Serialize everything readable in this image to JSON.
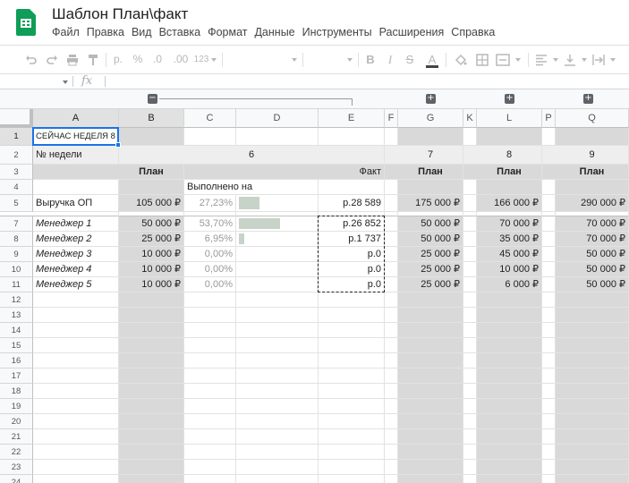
{
  "app": {
    "title": "Шаблон План\\факт",
    "menu": [
      "Файл",
      "Правка",
      "Вид",
      "Вставка",
      "Формат",
      "Данные",
      "Инструменты",
      "Расширения",
      "Справка"
    ]
  },
  "toolbar": {
    "currency": "р.",
    "percent": "%",
    "dec_decrease": ".0",
    "dec_increase": ".00",
    "more_formats": "123",
    "bold": "B",
    "italic": "I",
    "strike": "S",
    "text_color": "A"
  },
  "formula_bar": {
    "fx": "fx",
    "value": ""
  },
  "columns": [
    "A",
    "B",
    "C",
    "D",
    "E",
    "F",
    "G",
    "K",
    "L",
    "P",
    "Q"
  ],
  "rows": [
    "1",
    "2",
    "3",
    "4",
    "5",
    "7",
    "8",
    "9",
    "10",
    "11",
    "12",
    "13",
    "14",
    "15",
    "16",
    "17",
    "18",
    "19",
    "20",
    "21",
    "22",
    "23",
    "24"
  ],
  "cells": {
    "a1": "СЕЙЧАС НЕДЕЛЯ 8",
    "a2": "№ недели",
    "d2": "6",
    "g2": "7",
    "l2": "8",
    "q2": "9",
    "b3": "План",
    "e3": "Факт",
    "g3": "План",
    "l3": "План",
    "q3": "План",
    "c4": "Выполнено на",
    "revenue": {
      "label": "Выручка ОП",
      "plan": "105 000 ₽",
      "pct": "27,23%",
      "fact": "р.28 589",
      "w7": "175 000 ₽",
      "w8": "166 000 ₽",
      "w9": "290 000 ₽"
    },
    "managers": [
      {
        "label": "Менеджер 1",
        "plan": "50 000 ₽",
        "pct": "53,70%",
        "fact": "р.26 852",
        "w7": "50 000 ₽",
        "w8": "70 000 ₽",
        "w9": "70 000 ₽"
      },
      {
        "label": "Менеджер 2",
        "plan": "25 000 ₽",
        "pct": "6,95%",
        "fact": "р.1 737",
        "w7": "50 000 ₽",
        "w8": "35 000 ₽",
        "w9": "70 000 ₽"
      },
      {
        "label": "Менеджер 3",
        "plan": "10 000 ₽",
        "pct": "0,00%",
        "fact": "р.0",
        "w7": "25 000 ₽",
        "w8": "45 000 ₽",
        "w9": "50 000 ₽"
      },
      {
        "label": "Менеджер 4",
        "plan": "10 000 ₽",
        "pct": "0,00%",
        "fact": "р.0",
        "w7": "25 000 ₽",
        "w8": "10 000 ₽",
        "w9": "50 000 ₽"
      },
      {
        "label": "Менеджер 5",
        "plan": "10 000 ₽",
        "pct": "0,00%",
        "fact": "р.0",
        "w7": "25 000 ₽",
        "w8": "6 000 ₽",
        "w9": "50 000 ₽"
      }
    ]
  },
  "progress": {
    "revenue": 0.2723,
    "m1": 0.537,
    "m2": 0.0695,
    "m3": 0,
    "m4": 0,
    "m5": 0
  },
  "group_buttons": {
    "collapse": "−",
    "expand": "+"
  },
  "colors": {
    "accent": "#1a73e8",
    "gray_fill": "#d9d9d9",
    "bar": "#c7d3c8",
    "brand": "#0f9d58"
  }
}
